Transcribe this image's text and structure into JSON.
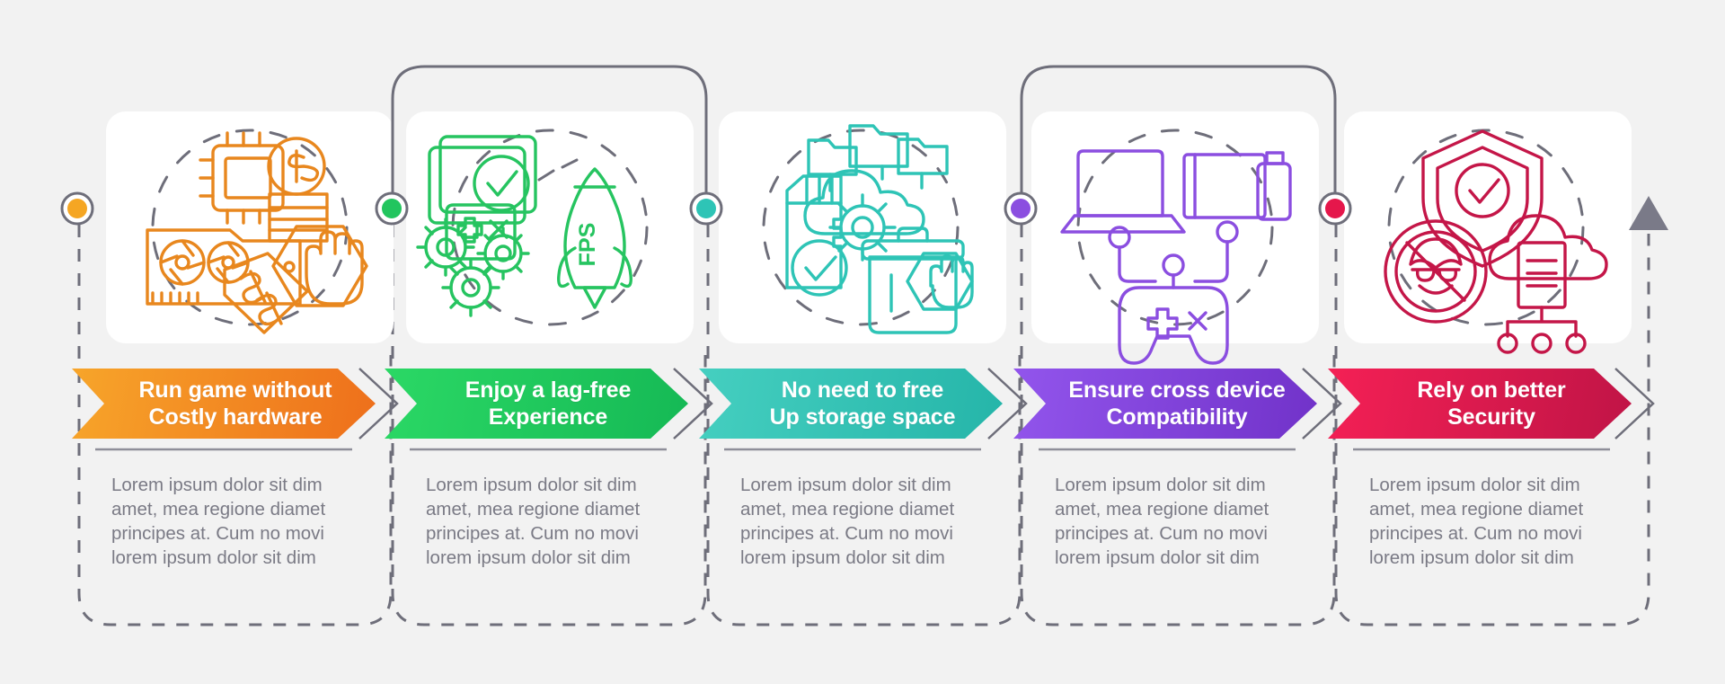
{
  "diagram": {
    "type": "process-steps-infographic",
    "background_color": "#f2f2f2",
    "card_color": "#ffffff",
    "connector_color": "#6e6e7a",
    "body_text_color": "#7a7a85",
    "end_marker": "arrow-up-triangle"
  },
  "steps": [
    {
      "index": 1,
      "title": "Run game without\nCostly hardware",
      "description": "Lorem ipsum dolor sit dim\namet, mea regione diamet\nprincipes at. Cum no movi\nlorem ipsum dolor sit dim",
      "color": "#f59b1f",
      "color_end": "#ed6f1e",
      "node_color": "#f5a623",
      "icon_names": [
        "cpu-chip-dollar-icon",
        "graphics-card-price-tag-icon",
        "stop-hand-hexagon-icon"
      ],
      "has_arc": false
    },
    {
      "index": 2,
      "title": "Enjoy a lag-free\nExperience",
      "description": "Lorem ipsum dolor sit dim\namet, mea regione diamet\nprincipes at. Cum no movi\nlorem ipsum dolor sit dim",
      "color": "#26c460",
      "color_end": "#2bd865",
      "node_color": "#22c55e",
      "icon_names": [
        "monitor-check-gamepad-icon",
        "gears-icon",
        "rocket-fps-icon"
      ],
      "has_arc": true
    },
    {
      "index": 3,
      "title": "No need to free\nUp storage space",
      "description": "Lorem ipsum dolor sit dim\namet, mea regione diamet\nprincipes at. Cum no movi\nlorem ipsum dolor sit dim",
      "color": "#3bc9bd",
      "color_end": "#2bb3a8",
      "node_color": "#2ec4b6",
      "icon_names": [
        "sd-card-check-icon",
        "cloud-gear-folders-icon",
        "trash-stop-hand-icon"
      ],
      "has_arc": false
    },
    {
      "index": 4,
      "title": "Ensure cross device\nCompatibility",
      "description": "Lorem ipsum dolor sit dim\namet, mea regione diamet\nprincipes at. Cum no movi\nlorem ipsum dolor sit dim",
      "color": "#8a4fe0",
      "color_end": "#7b3fd4",
      "node_color": "#8b4ee0",
      "icon_names": [
        "laptop-icon",
        "tablet-phone-icon",
        "gamepad-connected-icon"
      ],
      "has_arc": true
    },
    {
      "index": 5,
      "title": "Rely on better\nSecurity",
      "description": "Lorem ipsum dolor sit dim\namet, mea regione diamet\nprincipes at. Cum no movi\nlorem ipsum dolor sit dim",
      "color": "#ec1e52",
      "color_end": "#c41648",
      "node_color": "#e5174b",
      "icon_names": [
        "shield-check-icon",
        "hacker-blocked-icon",
        "cloud-document-network-icon"
      ],
      "has_arc": false
    }
  ]
}
